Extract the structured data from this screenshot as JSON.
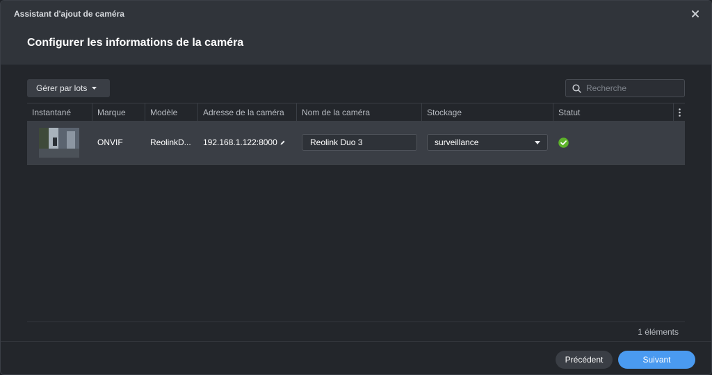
{
  "window": {
    "title": "Assistant d'ajout de caméra",
    "close_icon": "close-icon"
  },
  "page": {
    "title": "Configurer les informations de la caméra"
  },
  "toolbar": {
    "batch_label": "Gérer par lots",
    "search_placeholder": "Recherche",
    "search_value": ""
  },
  "table": {
    "columns": [
      "Instantané",
      "Marque",
      "Modèle",
      "Adresse de la caméra",
      "Nom de la caméra",
      "Stockage",
      "Statut"
    ],
    "rows": [
      {
        "brand": "ONVIF",
        "model": "ReolinkD...",
        "address": "192.168.1.122:8000",
        "name": "Reolink Duo 3",
        "storage": "surveillance",
        "status": "ok"
      }
    ]
  },
  "footer": {
    "count": "1 éléments",
    "prev_label": "Précédent",
    "next_label": "Suivant"
  },
  "colors": {
    "accent": "#4a9af0",
    "status_ok": "#5db22a"
  }
}
